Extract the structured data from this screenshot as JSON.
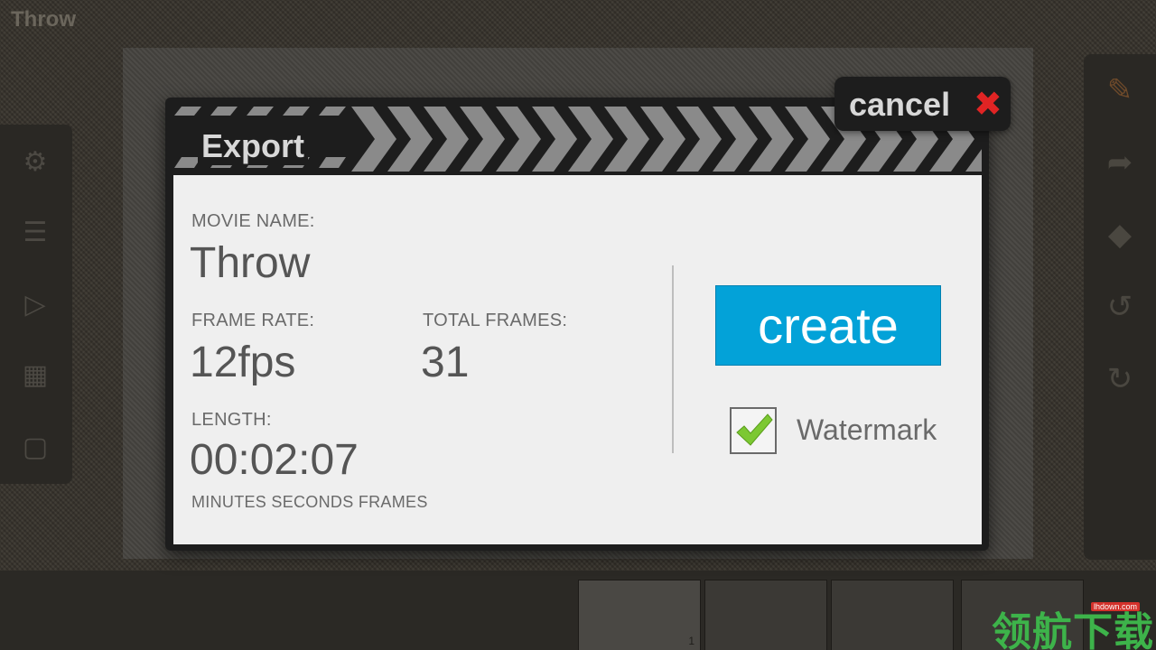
{
  "app": {
    "title": "Throw"
  },
  "dialog": {
    "title": "Export",
    "cancel_label": "cancel",
    "movie_name_label": "MOVIE NAME:",
    "movie_name": "Throw",
    "frame_rate_label": "FRAME RATE:",
    "frame_rate": "12fps",
    "total_frames_label": "TOTAL FRAMES:",
    "total_frames": "31",
    "length_label": "LENGTH:",
    "length": "00:02:07",
    "length_units": "MINUTES SECONDS FRAMES",
    "create_label": "create",
    "watermark_label": "Watermark",
    "watermark_checked": true
  },
  "filmstrip": {
    "first_frame_number": "1"
  },
  "branding": {
    "logo_text": "领航下载",
    "url": "lhdown.com"
  },
  "colors": {
    "accent": "#03a2d8",
    "cancel_icon": "#e02424",
    "check": "#7cc832"
  },
  "icons": {
    "cancel": "close-icon",
    "watermark": "checkmark-icon"
  }
}
